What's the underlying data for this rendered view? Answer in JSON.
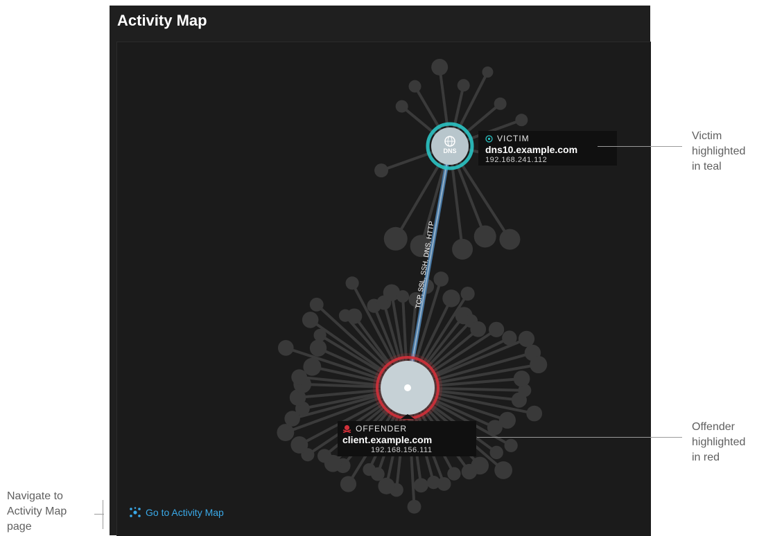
{
  "panel": {
    "title": "Activity Map"
  },
  "map": {
    "edge_label": "TCP, SSL, SSH, DNS, HTTP",
    "victim": {
      "role": "VICTIM",
      "hostname": "dns10.example.com",
      "ip": "192.168.241.112",
      "node_text": "DNS",
      "color": "#2bc4c4"
    },
    "offender": {
      "role": "OFFENDER",
      "hostname": "client.example.com",
      "ip": "192.168.156.111",
      "color": "#d2303a"
    }
  },
  "link": {
    "label": "Go to Activity Map",
    "color": "#3aa9e8"
  },
  "annotations": {
    "victim": "Victim highlighted in teal",
    "offender": "Offender highlighted in red",
    "navigate": "Navigate to Activity Map page"
  }
}
